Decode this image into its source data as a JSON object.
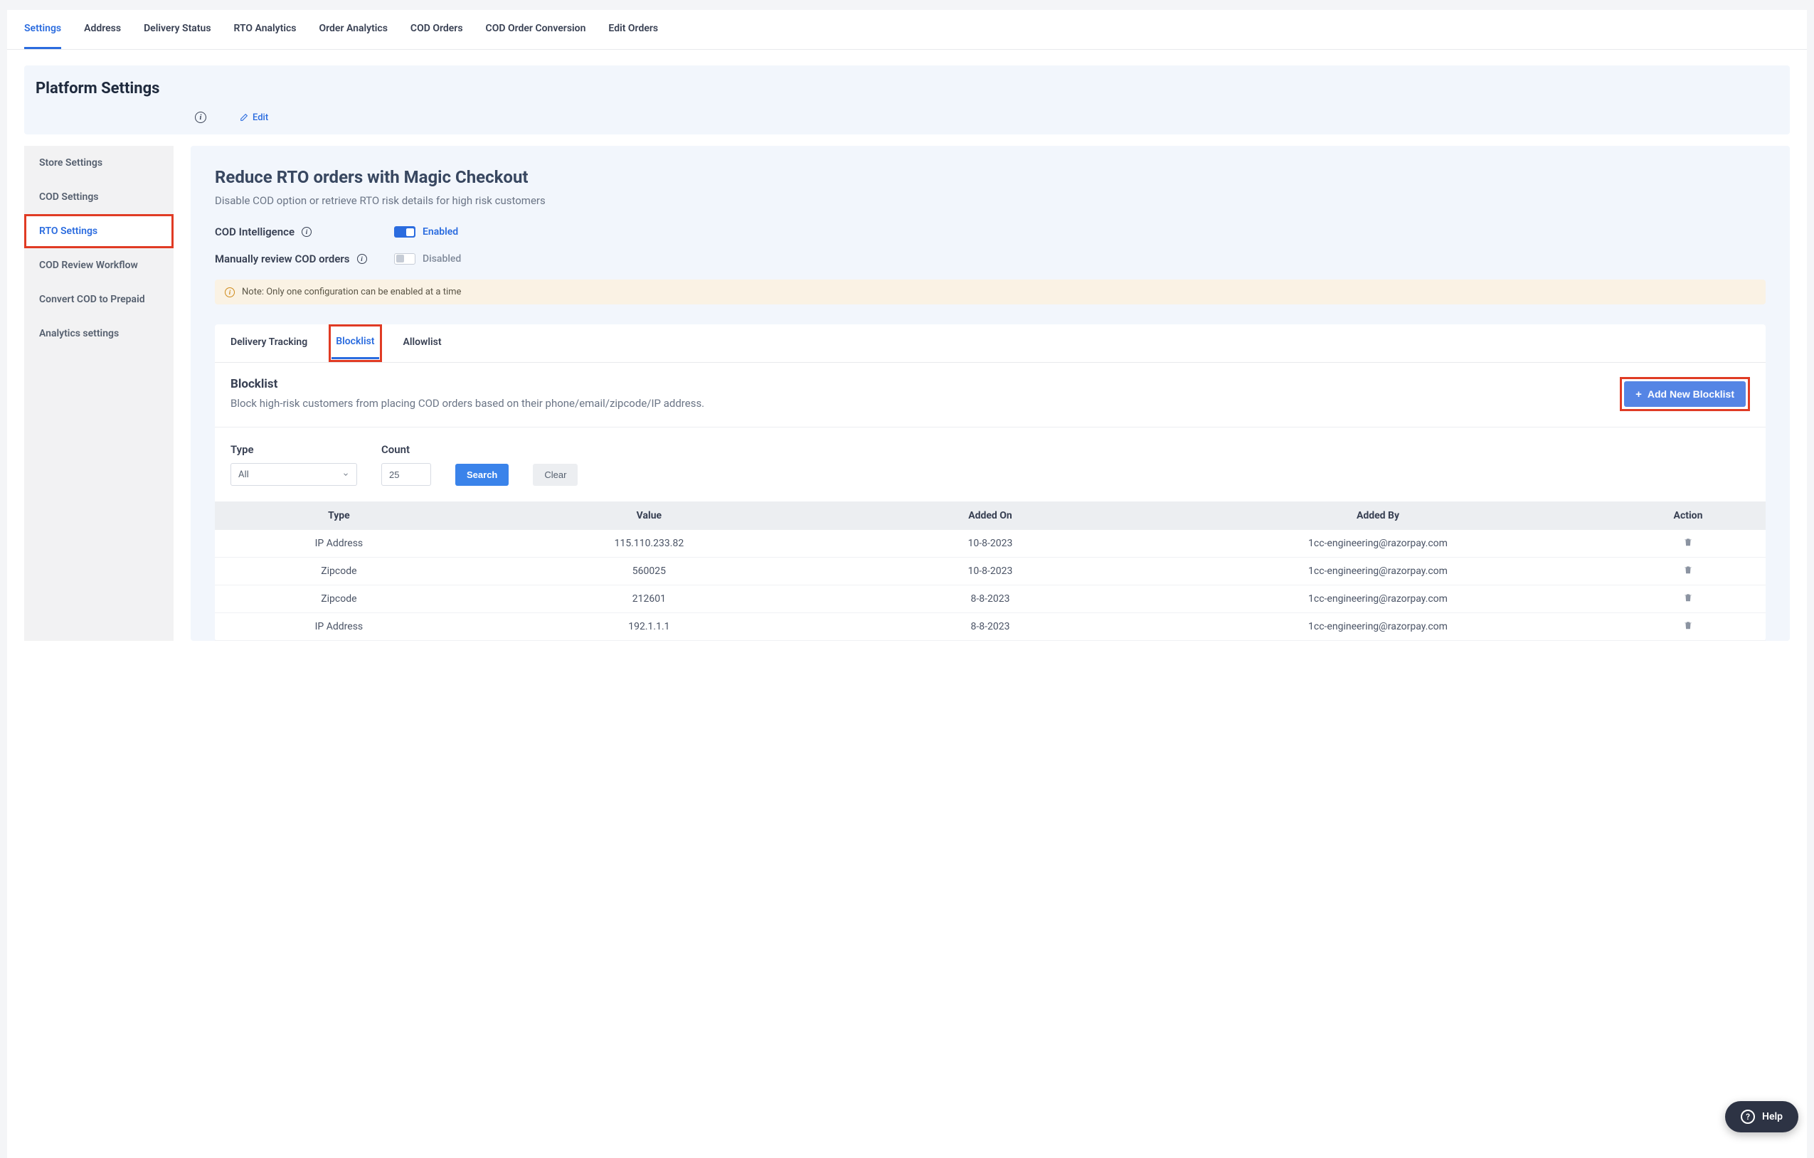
{
  "top_tabs": [
    "Settings",
    "Address",
    "Delivery Status",
    "RTO Analytics",
    "Order Analytics",
    "COD Orders",
    "COD Order Conversion",
    "Edit Orders"
  ],
  "top_tabs_active": 0,
  "platform": {
    "title": "Platform Settings",
    "edit": "Edit"
  },
  "sidebar": {
    "items": [
      "Store Settings",
      "COD Settings",
      "RTO Settings",
      "COD Review Workflow",
      "Convert COD to Prepaid",
      "Analytics settings"
    ],
    "active": 2
  },
  "card": {
    "title": "Reduce RTO orders with Magic Checkout",
    "subtitle": "Disable COD option or retrieve RTO risk details for high risk customers",
    "setting1_label": "COD Intelligence",
    "setting1_status": "Enabled",
    "setting2_label": "Manually review COD orders",
    "setting2_status": "Disabled",
    "note": "Note: Only one configuration can be enabled at a time"
  },
  "inner_tabs": [
    "Delivery Tracking",
    "Blocklist",
    "Allowlist"
  ],
  "inner_tabs_active": 1,
  "section": {
    "title": "Blocklist",
    "desc": "Block high-risk customers from placing COD orders based on their phone/email/zipcode/IP address.",
    "add_btn": "Add New Blocklist"
  },
  "filters": {
    "type_label": "Type",
    "type_value": "All",
    "count_label": "Count",
    "count_value": "25",
    "search": "Search",
    "clear": "Clear"
  },
  "table": {
    "headers": [
      "Type",
      "Value",
      "Added On",
      "Added By",
      "Action"
    ],
    "rows": [
      {
        "type": "IP Address",
        "value": "115.110.233.82",
        "added_on": "10-8-2023",
        "added_by": "1cc-engineering@razorpay.com"
      },
      {
        "type": "Zipcode",
        "value": "560025",
        "added_on": "10-8-2023",
        "added_by": "1cc-engineering@razorpay.com"
      },
      {
        "type": "Zipcode",
        "value": "212601",
        "added_on": "8-8-2023",
        "added_by": "1cc-engineering@razorpay.com"
      },
      {
        "type": "IP Address",
        "value": "192.1.1.1",
        "added_on": "8-8-2023",
        "added_by": "1cc-engineering@razorpay.com"
      }
    ]
  },
  "help": "Help"
}
